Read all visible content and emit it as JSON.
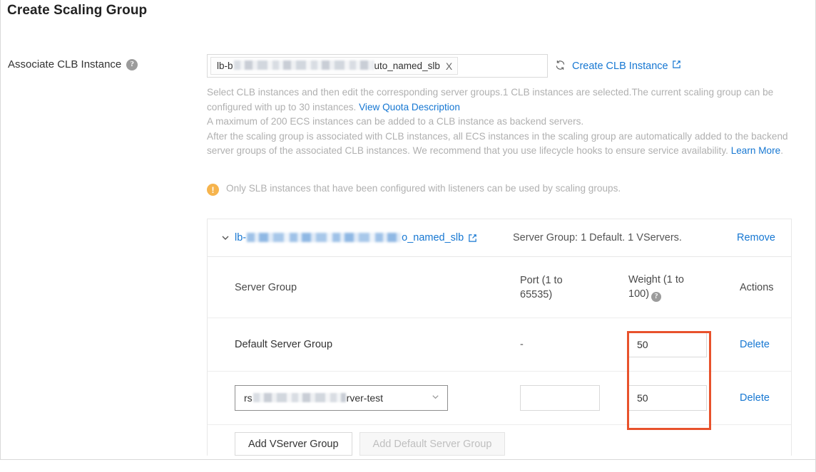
{
  "page": {
    "title": "Create Scaling Group"
  },
  "form": {
    "label": "Associate CLB Instance",
    "help_icon": "question-mark-icon",
    "tag": {
      "prefix": "lb-b",
      "suffix": "uto_named_slb",
      "remove": "X"
    },
    "refresh_icon": "refresh-icon",
    "create_link": "Create CLB Instance",
    "external_icon": "external-link-icon"
  },
  "description": {
    "line1_a": "Select CLB instances and then edit the corresponding server groups.1 CLB instances are selected.The current scaling group can be configured with up to 30 instances. ",
    "line1_link": "View Quota Description",
    "line2": "A maximum of 200 ECS instances can be added to a CLB instance as backend servers.",
    "line3": "After the scaling group is associated with CLB instances, all ECS instances in the scaling group are automatically added to the backend server groups of the associated CLB instances. We recommend that you use lifecycle hooks to ensure service availability. ",
    "line3_link": "Learn More",
    "line3_end": "."
  },
  "warning": {
    "icon": "warning-exclamation-icon",
    "text": "Only SLB instances that have been configured with listeners can be used by scaling groups."
  },
  "clb_card": {
    "collapse_icon": "chevron-down-icon",
    "name_prefix": "lb-",
    "name_suffix": "o_named_slb",
    "external_icon": "external-link-icon",
    "server_group_info": "Server Group: 1 Default. 1 VServers.",
    "remove_label": "Remove",
    "table": {
      "headers": {
        "group": "Server Group",
        "port": "Port (1 to 65535)",
        "port_l1": "Port (1 to",
        "port_l2": "65535)",
        "weight": "Weight (1 to 100)",
        "weight_l1": "Weight (1 to",
        "weight_l2": "100)",
        "weight_help_icon": "question-mark-icon",
        "actions": "Actions"
      },
      "rows": [
        {
          "type": "default",
          "group_label": "Default Server Group",
          "port": "-",
          "weight": "50",
          "action": "Delete"
        },
        {
          "type": "vserver",
          "group_prefix": "rs",
          "group_suffix": "rver-test",
          "group_caret_icon": "chevron-down-icon",
          "port": "",
          "weight": "50",
          "action": "Delete"
        }
      ]
    },
    "buttons": {
      "add_vserver": "Add VServer Group",
      "add_default": "Add Default Server Group"
    }
  },
  "highlight": {
    "color": "#e8522c",
    "name": "weight-column-highlight"
  }
}
